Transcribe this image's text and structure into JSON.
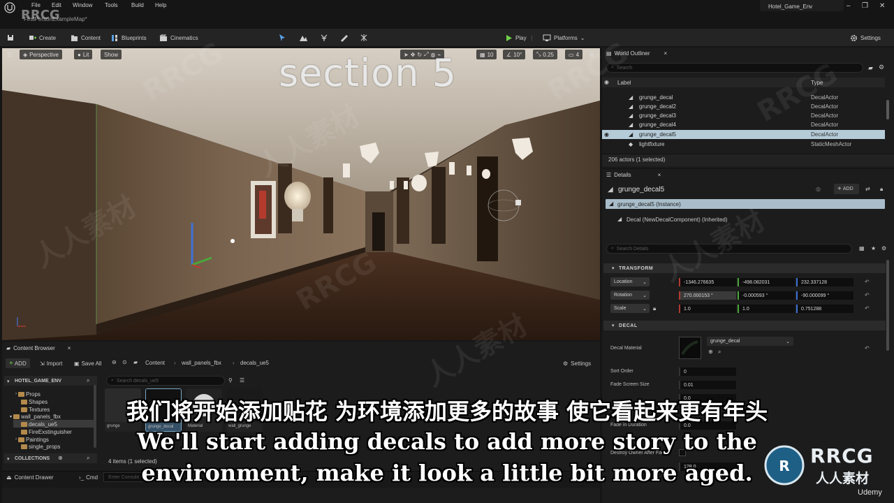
{
  "watermark": {
    "top_left_logo": "RRCG",
    "corner_brand": "RRCG",
    "corner_sub": "人人素材",
    "udemy": "Udemy",
    "tiles": [
      "RRCG",
      "人人素材"
    ]
  },
  "title_bar": {
    "map_tab": "FirstPersonExampleMap*",
    "project": "Hotel_Game_Env",
    "menu": [
      "File",
      "Edit",
      "Window",
      "Tools",
      "Build",
      "Help"
    ]
  },
  "toolbar": {
    "create": "Create",
    "content": "Content",
    "blueprints": "Blueprints",
    "cinematics": "Cinematics",
    "play": "Play",
    "platforms": "Platforms",
    "settings": "Settings"
  },
  "viewport": {
    "perspective": "Perspective",
    "lit": "Lit",
    "show": "Show",
    "grid_snap": "10",
    "angle_snap": "10°",
    "scale_snap": "0.25",
    "camera_speed": "4",
    "section_title": "section 5"
  },
  "outliner": {
    "tab": "World Outliner",
    "search_placeholder": "Search",
    "col_label": "Label",
    "col_type": "Type",
    "rows": [
      {
        "label": "grunge_decal",
        "type": "DecalActor"
      },
      {
        "label": "grunge_decal2",
        "type": "DecalActor"
      },
      {
        "label": "grunge_decal3",
        "type": "DecalActor"
      },
      {
        "label": "grunge_decal4",
        "type": "DecalActor"
      },
      {
        "label": "grunge_decal5",
        "type": "DecalActor"
      },
      {
        "label": "lightfixture",
        "type": "StaticMeshActor"
      }
    ],
    "footer": "206 actors (1 selected)"
  },
  "details": {
    "tab": "Details",
    "actor_name": "grunge_decal5",
    "add": "ADD",
    "instance": "grunge_decal5 (Instance)",
    "component": "Decal (NewDecalComponent) (Inherited)",
    "search_placeholder": "Search Details",
    "transform_header": "TRANSFORM",
    "location_label": "Location",
    "location": [
      "-1346.276635",
      "-498.082031",
      "232.337128"
    ],
    "rotation_label": "Rotation",
    "rotation": [
      "270.000153 °",
      "-0.000593 °",
      "-90.000099 °"
    ],
    "scale_label": "Scale",
    "scale": [
      "1.0",
      "1.0",
      "0.751288"
    ],
    "decal_header": "DECAL",
    "decal_material_label": "Decal Material",
    "decal_material_value": "grunge_decal",
    "sort_order_label": "Sort Order",
    "sort_order": "0",
    "fade_screen_size_label": "Fade Screen Size",
    "fade_screen_size": "0.01",
    "fade_start_delay": "0.0",
    "fade_duration_label": "Fade in Duration",
    "fade_duration": "0.0",
    "destroy_label": "Destroy Owner After Fade",
    "decal_size_value": "128.0"
  },
  "content_browser": {
    "tab": "Content Browser",
    "add": "ADD",
    "import": "Import",
    "save_all": "Save All",
    "breadcrumb": [
      "Content",
      "wall_panels_fbx",
      "decals_ue5"
    ],
    "settings": "Settings",
    "root": "HOTEL_GAME_ENV",
    "folders": [
      "Props",
      "Shapes",
      "Textures",
      "wall_panels_fbx",
      "decals_ue5",
      "FireExstinguisher",
      "Paintings",
      "single_props"
    ],
    "collections": "COLLECTIONS",
    "search_placeholder": "Search decals_ue5",
    "assets": [
      "grunge",
      "grunge_decal",
      "Material",
      "wall_grunge"
    ],
    "item_count": "4 items (1 selected)",
    "content_drawer": "Content Drawer",
    "cmd": "Cmd",
    "console_placeholder": "Enter Console Command"
  },
  "subtitles": {
    "chinese": "我们将开始添加贴花 为环境添加更多的故事 使它看起来更有年头",
    "english_line1": "We'll start adding decals to add more story to the",
    "english_line2": "environment, make it look a little bit more aged."
  }
}
